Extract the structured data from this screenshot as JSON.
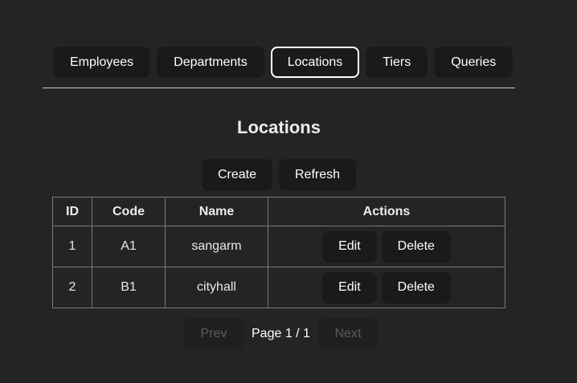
{
  "nav": {
    "tabs": [
      {
        "label": "Employees",
        "active": false
      },
      {
        "label": "Departments",
        "active": false
      },
      {
        "label": "Locations",
        "active": true
      },
      {
        "label": "Tiers",
        "active": false
      },
      {
        "label": "Queries",
        "active": false
      }
    ]
  },
  "page": {
    "title": "Locations"
  },
  "toolbar": {
    "create_label": "Create",
    "refresh_label": "Refresh"
  },
  "table": {
    "columns": [
      "ID",
      "Code",
      "Name",
      "Actions"
    ],
    "rows": [
      {
        "id": "1",
        "code": "A1",
        "name": "sangarm",
        "edit_label": "Edit",
        "delete_label": "Delete"
      },
      {
        "id": "2",
        "code": "B1",
        "name": "cityhall",
        "edit_label": "Edit",
        "delete_label": "Delete"
      }
    ]
  },
  "pagination": {
    "prev_label": "Prev",
    "page_info": "Page 1 / 1",
    "next_label": "Next",
    "prev_enabled": false,
    "next_enabled": false
  },
  "colors": {
    "background": "#242424",
    "button_background": "#1a1a1a",
    "active_border": "#ffffff",
    "disabled_text": "#5c5c5c",
    "table_border": "#7a7a7a"
  }
}
